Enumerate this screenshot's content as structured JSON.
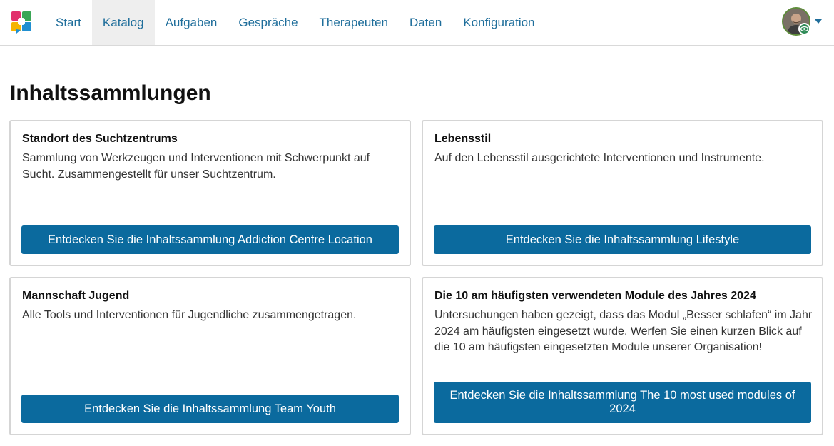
{
  "nav": {
    "items": [
      {
        "label": "Start"
      },
      {
        "label": "Katalog"
      },
      {
        "label": "Aufgaben"
      },
      {
        "label": "Gespräche"
      },
      {
        "label": "Therapeuten"
      },
      {
        "label": "Daten"
      },
      {
        "label": "Konfiguration"
      }
    ],
    "active": "Katalog"
  },
  "colors": {
    "nav_link": "#1f6e9b",
    "button_bg": "#0b6a9e",
    "active_nav_bg": "#eeeeee"
  },
  "page": {
    "title": "Inhaltssammlungen"
  },
  "collections": [
    {
      "title": "Standort des Suchtzentrums",
      "description": "Sammlung von Werkzeugen und Interventionen mit Schwerpunkt auf Sucht. Zusammengestellt für unser Suchtzentrum.",
      "button": "Entdecken Sie die Inhaltssammlung Addiction Centre Location"
    },
    {
      "title": "Lebensstil",
      "description": "Auf den Lebensstil ausgerichtete Interventionen und Instrumente.",
      "button": "Entdecken Sie die Inhaltssammlung Lifestyle"
    },
    {
      "title": "Mannschaft Jugend",
      "description": "Alle Tools und Interventionen für Jugendliche zusammengetragen.",
      "button": "Entdecken Sie die Inhaltssammlung Team Youth"
    },
    {
      "title": "Die 10 am häufigsten verwendeten Module des Jahres 2024",
      "description": "Untersuchungen haben gezeigt, dass das Modul „Besser schlafen“ im Jahr 2024 am häufigsten eingesetzt wurde. Werfen Sie einen kurzen Blick auf die 10 am häufigsten eingesetzten Module unserer Organisation!",
      "button": "Entdecken Sie die Inhaltssammlung The 10 most used modules of 2024"
    }
  ],
  "icons": {
    "logo": "app-logo-icon",
    "avatar": "user-avatar",
    "badge": "eye-icon",
    "menu": "chevron-down-icon"
  }
}
